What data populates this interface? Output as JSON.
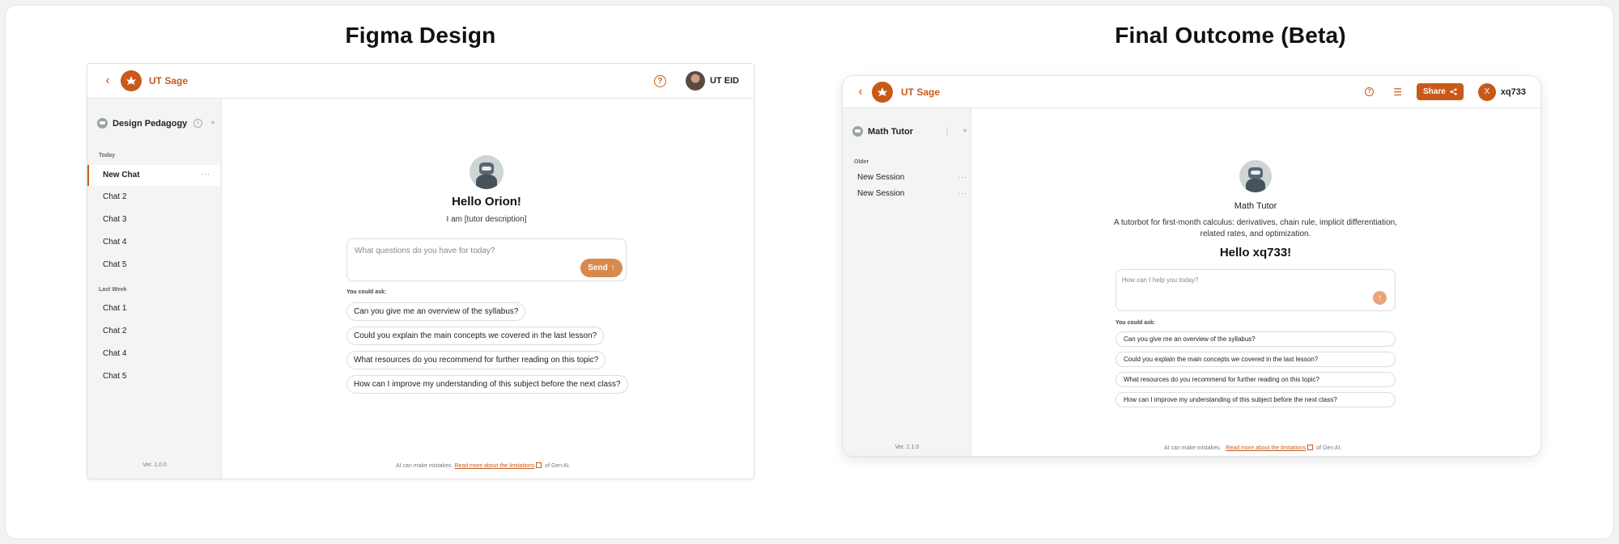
{
  "titles": {
    "left": "Figma Design",
    "right": "Final Outcome (Beta)"
  },
  "colors": {
    "accent": "#c85a19"
  },
  "figma": {
    "brand": "UT Sage",
    "user": "UT EID",
    "tutor_name": "Design Pedagogy",
    "groups": [
      {
        "label": "Today",
        "items": [
          "New Chat",
          "Chat 2",
          "Chat 3",
          "Chat 4",
          "Chat 5"
        ]
      },
      {
        "label": "Last Week",
        "items": [
          "Chat 1",
          "Chat 2",
          "Chat 4",
          "Chat 5"
        ]
      }
    ],
    "version": "Ver. 1.0.0",
    "greeting": "Hello Orion!",
    "description": "I am [tutor description]",
    "placeholder": "What questions do you have for today?",
    "send_label": "Send",
    "you_could_ask": "You could ask:",
    "suggestions": [
      "Can you give me an overview of the syllabus?",
      "Could you explain the main concepts we covered in the last lesson?",
      "What resources do you recommend for further reading on this topic?",
      "How can I improve my understanding of this subject before the next class?"
    ],
    "footer": {
      "pre": "AI can make mistakes.",
      "link": "Read more about the limitations",
      "post": "of Gen AI."
    }
  },
  "final": {
    "brand": "UT Sage",
    "share_label": "Share",
    "user_initial": "X",
    "user": "xq733",
    "tutor_name": "Math Tutor",
    "group_label": "Older",
    "items": [
      "New Session",
      "New Session"
    ],
    "version": "Ver. 1.1.0",
    "title": "Math Tutor",
    "description_line1": "A tutorbot for first-month calculus: derivatives, chain rule, implicit differentiation,",
    "description_line2": "related rates, and optimization.",
    "greeting": "Hello xq733!",
    "placeholder": "How can I help you today?",
    "you_could_ask": "You could ask:",
    "suggestions": [
      "Can you give me an overview of the syllabus?",
      "Could you explain the main concepts we covered in the last lesson?",
      "What resources do you recommend for further reading on this topic?",
      "How can I improve my understanding of this subject before the next class?"
    ],
    "footer": {
      "pre": "AI can make mistakes.",
      "link": "Read more about the limitations",
      "post": "of Gen AI."
    }
  }
}
